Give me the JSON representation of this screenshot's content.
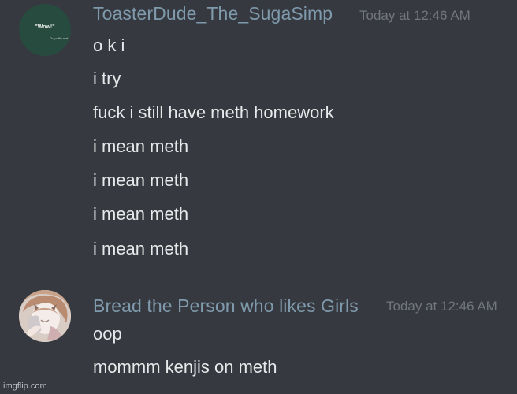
{
  "messages_area": {
    "group_1": {
      "author": "ToasterDude_The_SugaSimp",
      "timestamp": "Today at 12:46 AM",
      "avatar": {
        "quote": "\"Wow!\"",
        "subtext": "— Guy with mat"
      },
      "messages": [
        "o k i",
        "i try",
        "fuck i still have meth homework",
        "i mean meth",
        "i mean meth",
        "i mean meth",
        "i mean meth"
      ]
    },
    "group_2": {
      "author": "Bread the Person who likes Girls",
      "timestamp": "Today at 12:46 AM",
      "messages": [
        "oop",
        "mommm kenjis on meth"
      ]
    }
  },
  "watermark": "imgflip.com",
  "colors": {
    "background": "#36393f",
    "username": "#7f9aac",
    "timestamp": "#72767d",
    "message_text": "#e7e8ea"
  }
}
